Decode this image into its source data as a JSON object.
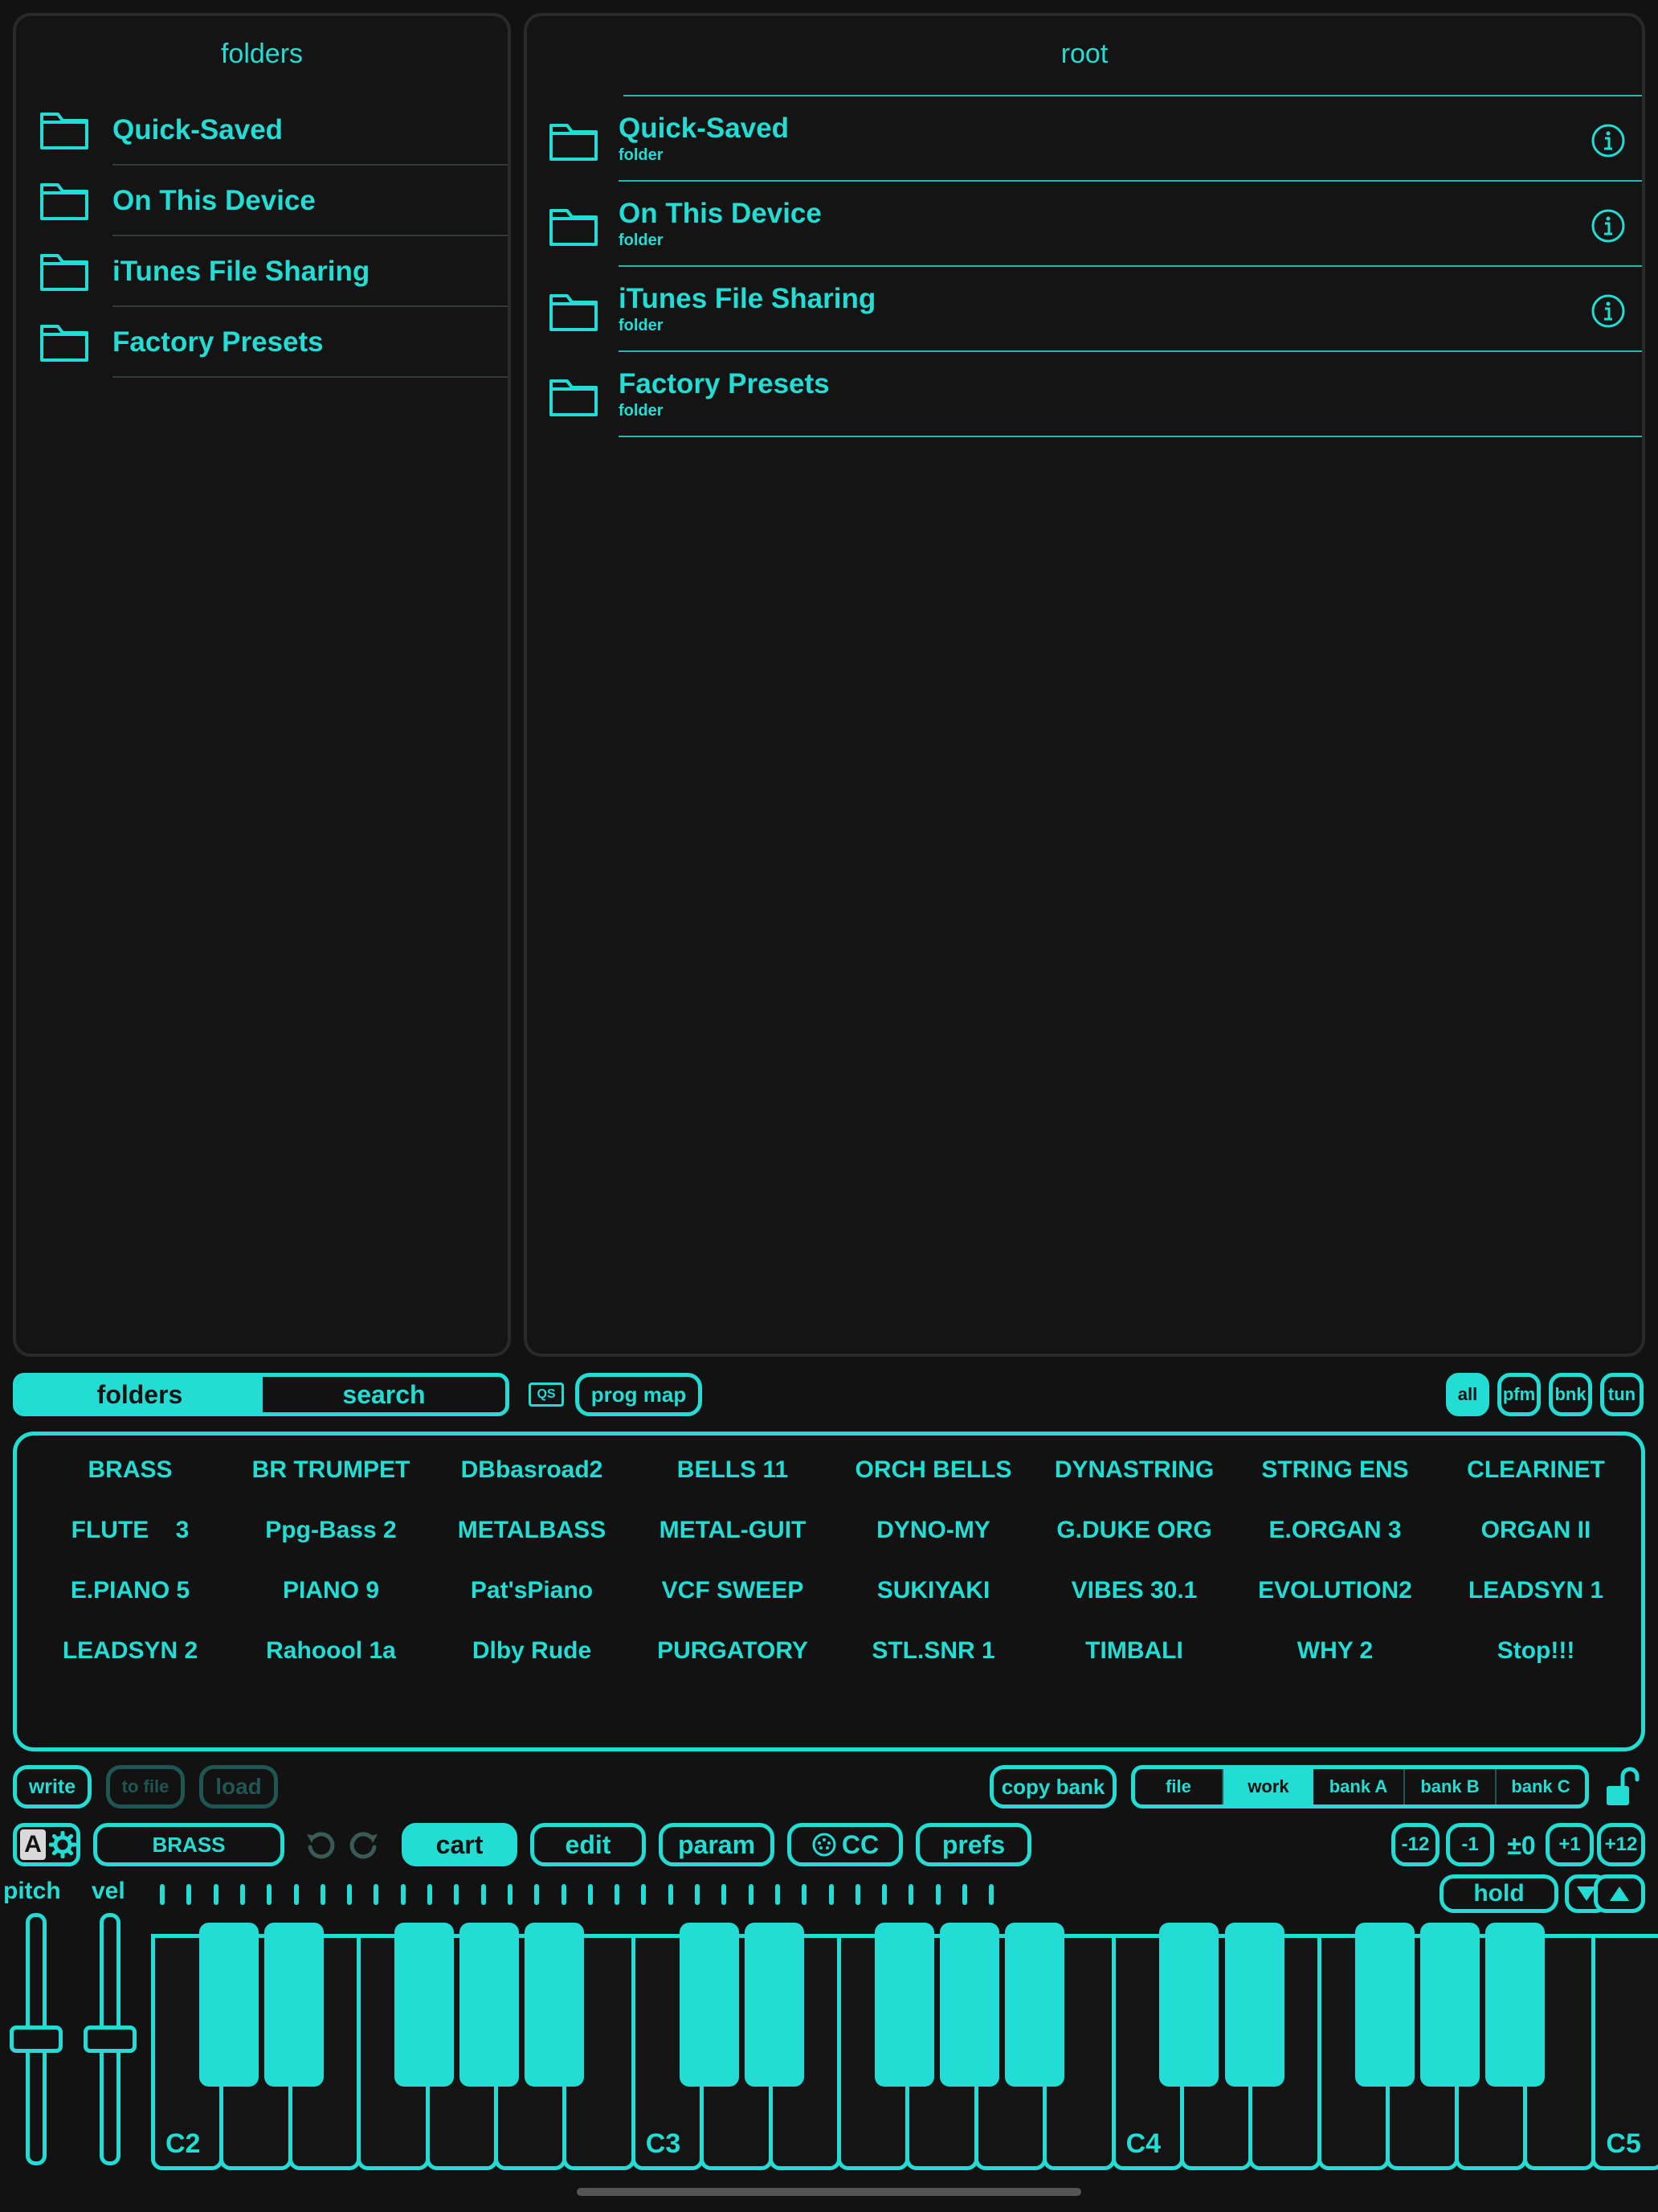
{
  "left_panel": {
    "title": "folders",
    "items": [
      {
        "label": "Quick-Saved"
      },
      {
        "label": "On This Device"
      },
      {
        "label": "iTunes File Sharing"
      },
      {
        "label": "Factory Presets"
      }
    ]
  },
  "right_panel": {
    "title": "root",
    "items": [
      {
        "label": "Quick-Saved",
        "sub": "folder",
        "has_info": true
      },
      {
        "label": "On This Device",
        "sub": "folder",
        "has_info": true
      },
      {
        "label": "iTunes File Sharing",
        "sub": "folder",
        "has_info": true
      },
      {
        "label": "Factory Presets",
        "sub": "folder",
        "has_info": false
      }
    ]
  },
  "browser_tabs": {
    "folders": "folders",
    "search": "search",
    "active": "folders"
  },
  "qs_icon_label": "QS",
  "prog_map": "prog map",
  "filters": {
    "all": "all",
    "pfm": "pfm",
    "bnk": "bnk",
    "tun": "tun",
    "active": "all"
  },
  "voices": [
    "BRASS",
    "BR TRUMPET",
    "DBbasroad2",
    "BELLS 11",
    "ORCH BELLS",
    "DYNASTRING",
    "STRING ENS",
    "CLEARINET",
    "FLUTE    3",
    "Ppg-Bass 2",
    "METALBASS",
    "METAL-GUIT",
    "DYNO-MY",
    "G.DUKE ORG",
    "E.ORGAN 3",
    "ORGAN II",
    "E.PIANO 5",
    "PIANO 9",
    "Pat'sPiano",
    "VCF SWEEP",
    "SUKIYAKI",
    "VIBES 30.1",
    "EVOLUTION2",
    "LEADSYN 1",
    "LEADSYN 2",
    "Rahoool 1a",
    "Dlby Rude",
    "PURGATORY",
    "STL.SNR 1",
    "TIMBALI",
    "WHY 2",
    "Stop!!!"
  ],
  "actions": {
    "write": "write",
    "to_file": "to file",
    "load": "load",
    "copy_bank": "copy bank"
  },
  "bank_tabs": {
    "file": "file",
    "work": "work",
    "bank_a": "bank A",
    "bank_b": "bank B",
    "bank_c": "bank C",
    "active": "work"
  },
  "voice_name": "BRASS",
  "mode_tabs": {
    "cart": "cart",
    "edit": "edit",
    "param": "param",
    "cc": "CC",
    "prefs": "prefs",
    "active": "cart"
  },
  "transpose": {
    "m12": "-12",
    "m1": "-1",
    "zero": "±0",
    "p1": "+1",
    "p12": "+12"
  },
  "keyboard": {
    "hold": "hold",
    "pitch_label": "pitch",
    "vel_label": "vel",
    "octave_labels": [
      "C2",
      "C3",
      "C4",
      "C5"
    ]
  },
  "sliders": {
    "pitch": 0.5,
    "vel": 0.5
  },
  "colors": {
    "accent": "#23ddd4",
    "background": "#121212",
    "panel_border": "#2a2a2a"
  }
}
